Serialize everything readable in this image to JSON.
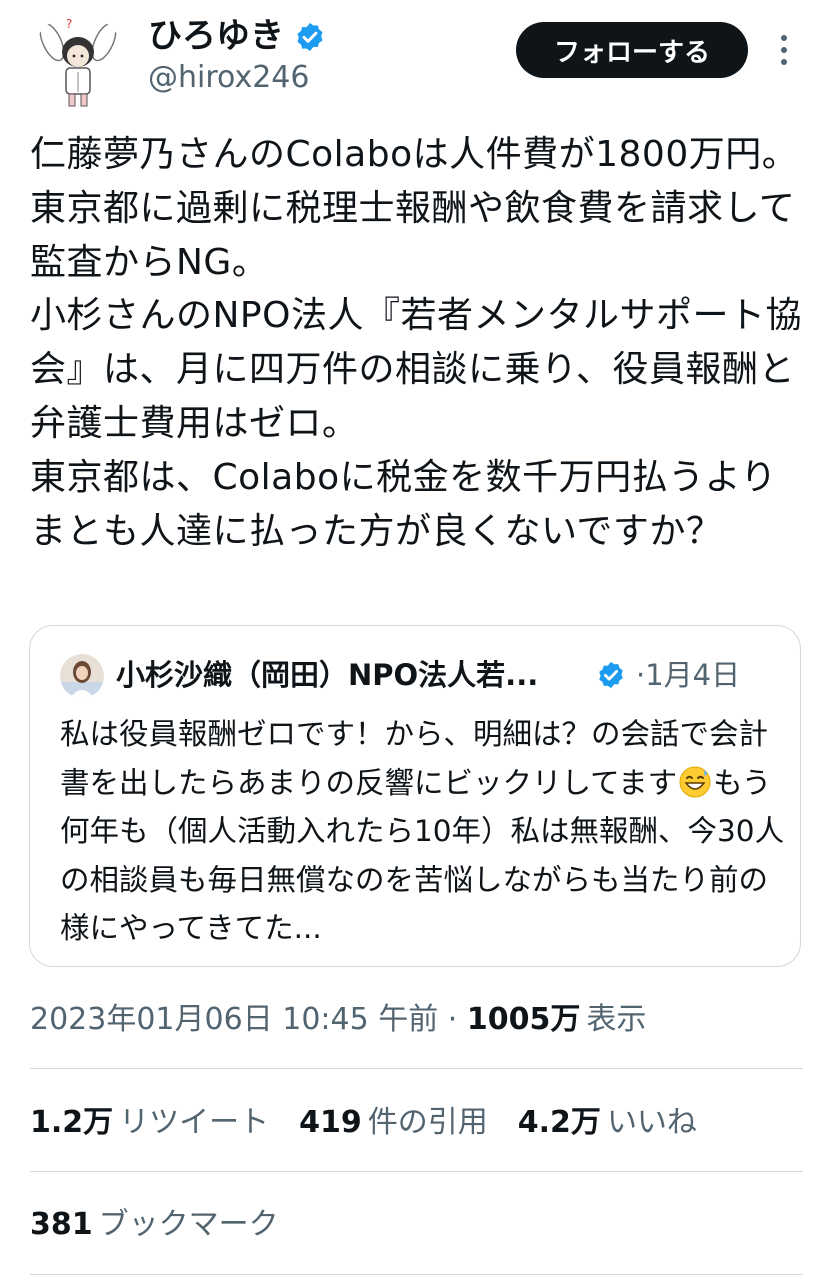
{
  "author": {
    "display_name": "ひろゆき",
    "handle": "@hirox246",
    "verified": true
  },
  "follow_button": {
    "label": "フォローする"
  },
  "more_icon": "more-vertical-icon",
  "tweet": {
    "text": "仁藤夢乃さんのColaboは人件費が1800万円。東京都に過剰に税理士報酬や飲食費を請求して監査からNG。\n小杉さんのNPO法人『若者メンタルサポート協会』は、月に四万件の相談に乗り、役員報酬と弁護士費用はゼロ。\n東京都は、Colaboに税金を数千万円払うよりまとも人達に払った方が良くないですか？"
  },
  "quote": {
    "display_name": "小杉沙織（岡田）NPO法人若...",
    "verified": true,
    "separator": "·",
    "date": "1月4日",
    "text_before_emoji": "私は役員報酬ゼロです！から、明細は？の会話で会計書を出したらあまりの反響にビックリしてます",
    "emoji": "grinning-sweat-emoji",
    "text_after_emoji": "もう何年も（個人活動入れたら10年）私は無報酬、今30人の相談員も毎日無償なのを苦悩しながらも当たり前の様にやってきてた..."
  },
  "meta": {
    "datetime": "2023年01月06日 10:45 午前",
    "separator": " · ",
    "views_count": "1005万",
    "views_label": "表示"
  },
  "stats": {
    "retweets": {
      "count": "1.2万",
      "label": "リツイート"
    },
    "quotes": {
      "count": "419",
      "label": "件の引用"
    },
    "likes": {
      "count": "4.2万",
      "label": "いいね"
    }
  },
  "bookmarks": {
    "count": "381",
    "label": "ブックマーク"
  },
  "colors": {
    "text": "#0f1419",
    "secondary": "#536471",
    "border": "#cfd9de",
    "verified": "#1d9bf0",
    "button_bg": "#0f1419"
  }
}
